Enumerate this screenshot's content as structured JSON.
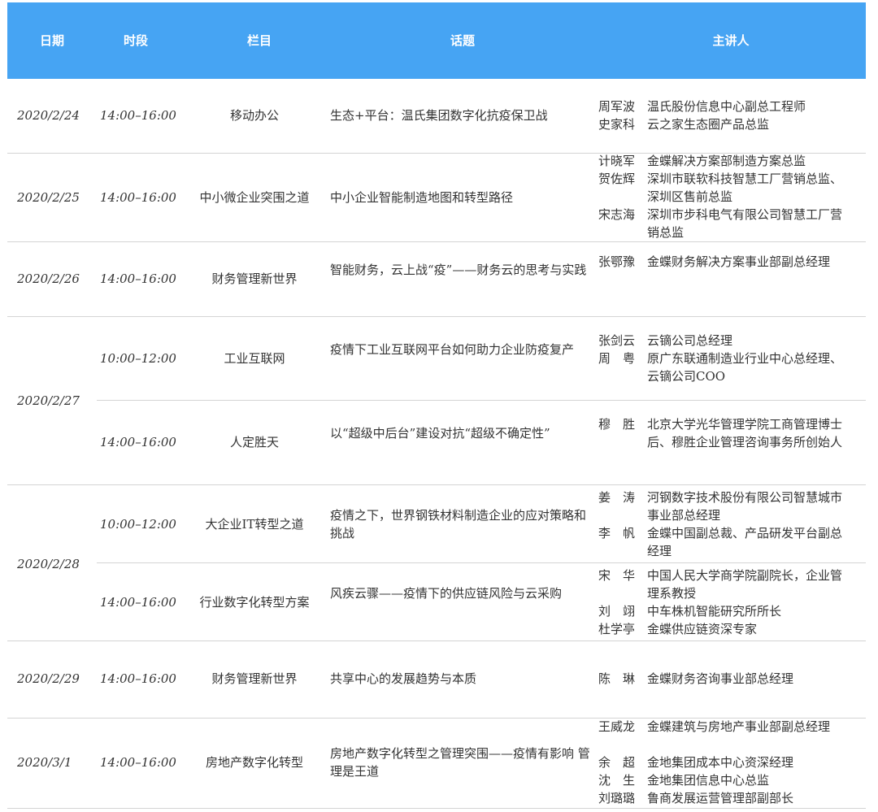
{
  "header": {
    "date": "日期",
    "time": "时段",
    "column": "栏目",
    "topic": "话题",
    "speaker": "主讲人"
  },
  "rows": [
    {
      "date": "2020/2/24",
      "time": "14:00–16:00",
      "column": "移动办公",
      "topic": "生态+平台：温氏集团数字化抗疫保卫战",
      "speakers": [
        {
          "name": "周军波",
          "title": "温氏股份信息中心副总工程师"
        },
        {
          "name": "史家科",
          "title": "云之家生态圈产品总监"
        }
      ]
    },
    {
      "date": "2020/2/25",
      "time": "14:00–16:00",
      "column": "中小微企业突围之道",
      "topic": "中小企业智能制造地图和转型路径",
      "speakers": [
        {
          "name": "计晓军",
          "title": "金蝶解决方案部制造方案总监"
        },
        {
          "name": "贺佐辉",
          "title": "深圳市联软科技智慧工厂营销总监、深圳区售前总监"
        },
        {
          "name": "宋志海",
          "title": "深圳市步科电气有限公司智慧工厂营销总监"
        }
      ]
    },
    {
      "date": "2020/2/26",
      "time": "14:00–16:00",
      "column": "财务管理新世界",
      "topic": "智能财务，云上战“疫”——财务云的思考与实践",
      "speakers": [
        {
          "name": "张鄂豫",
          "title": "金蝶财务解决方案事业部副总经理"
        }
      ]
    },
    {
      "date": "2020/2/27",
      "time": "10:00–12:00",
      "column": "工业互联网",
      "topic": "疫情下工业互联网平台如何助力企业防疫复产",
      "speakers": [
        {
          "name": "张剑云",
          "title": "云镝公司总经理"
        },
        {
          "name": "周　粤",
          "title": "原广东联通制造业行业中心总经理、云镝公司COO"
        }
      ]
    },
    {
      "date": "",
      "time": "14:00–16:00",
      "column": "人定胜天",
      "topic": "以“超级中后台”建设对抗“超级不确定性”",
      "speakers": [
        {
          "name": "穆　胜",
          "title": "北京大学光华管理学院工商管理博士后、穆胜企业管理咨询事务所创始人"
        }
      ]
    },
    {
      "date": "2020/2/28",
      "time": "10:00–12:00",
      "column": "大企业IT转型之道",
      "topic": "疫情之下，世界钢铁材料制造企业的应对策略和挑战",
      "speakers": [
        {
          "name": "姜　涛",
          "title": "河钢数字技术股份有限公司智慧城市事业部总经理"
        },
        {
          "name": "李　帆",
          "title": "金蝶中国副总裁、产品研发平台副总经理"
        }
      ]
    },
    {
      "date": "",
      "time": "14:00–16:00",
      "column": "行业数字化转型方案",
      "topic": "风疾云骤——疫情下的供应链风险与云采购",
      "speakers": [
        {
          "name": "宋　华",
          "title": "中国人民大学商学院副院长，企业管理系教授"
        },
        {
          "name": "刘　翊",
          "title": "中车株机智能研究所所长"
        },
        {
          "name": "杜学亭",
          "title": "金蝶供应链资深专家"
        }
      ]
    },
    {
      "date": "2020/2/29",
      "time": "14:00–16:00",
      "column": "财务管理新世界",
      "topic": "共享中心的发展趋势与本质",
      "speakers": [
        {
          "name": "陈　琳",
          "title": "金蝶财务咨询事业部总经理"
        }
      ]
    },
    {
      "date": "2020/3/1",
      "time": "14:00–16:00",
      "column": "房地产数字化转型",
      "topic": "房地产数字化转型之管理突围——疫情有影响 管理是王道",
      "speakers": [
        {
          "name": "王威龙",
          "title": "金蝶建筑与房地产事业部副总经理"
        },
        {
          "name": "余　超",
          "title": "金地集团成本中心资深经理"
        },
        {
          "name": "沈　生",
          "title": "金地集团信息中心总监"
        },
        {
          "name": "刘璐璐",
          "title": "鲁商发展运营管理部副部长"
        }
      ]
    }
  ]
}
